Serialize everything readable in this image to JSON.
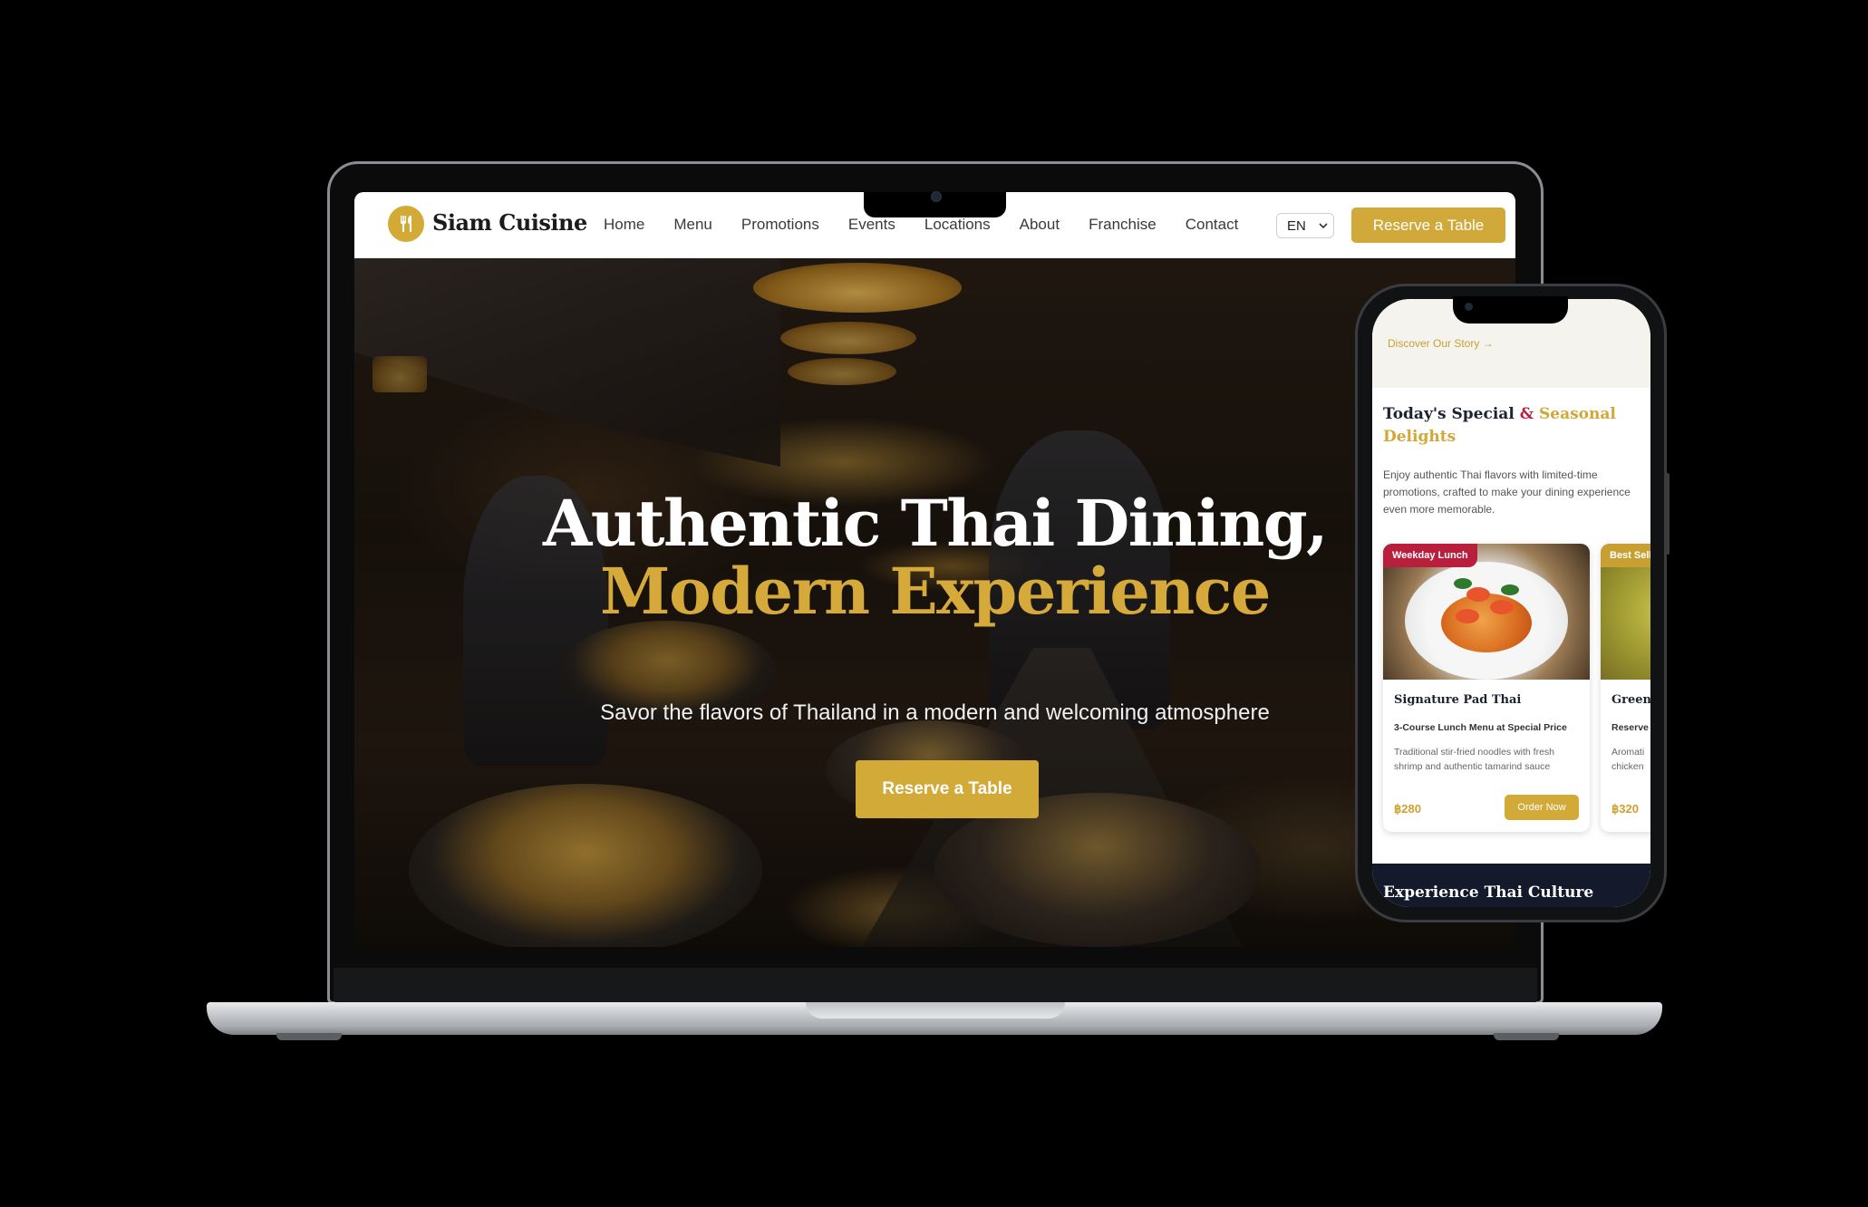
{
  "site": {
    "brand": "Siam Cuisine",
    "nav": [
      "Home",
      "Menu",
      "Promotions",
      "Events",
      "Locations",
      "About",
      "Franchise",
      "Contact"
    ],
    "language": "EN",
    "header_cta": "Reserve a Table"
  },
  "hero": {
    "title_line1": "Authentic Thai Dining,",
    "title_line2": "Modern Experience",
    "subtitle": "Savor the flavors of Thailand in a modern and welcoming atmosphere",
    "cta": "Reserve a Table"
  },
  "mobile": {
    "story_link": "Discover Our Story →",
    "section_title_part1": "Today's Special",
    "section_title_amp": "&",
    "section_title_part2": "Seasonal Delights",
    "section_desc": "Enjoy authentic Thai flavors with limited-time promotions, crafted to make your dining experience even more memorable.",
    "cards": [
      {
        "badge": "Weekday Lunch",
        "title": "Signature Pad Thai",
        "subtitle": "3-Course Lunch Menu at Special Price",
        "description": "Traditional stir-fried noodles with fresh shrimp and authentic tamarind sauce",
        "price": "฿280",
        "cta": "Order Now"
      },
      {
        "badge": "Best Sell",
        "title": "Green",
        "subtitle": "Reserve",
        "description": "Aromati chicken",
        "price": "฿320"
      }
    ],
    "next_section_title": "Experience Thai Culture"
  },
  "colors": {
    "gold": "#d2aa38",
    "navy": "#1d2233",
    "crimson": "#b81f3c"
  }
}
